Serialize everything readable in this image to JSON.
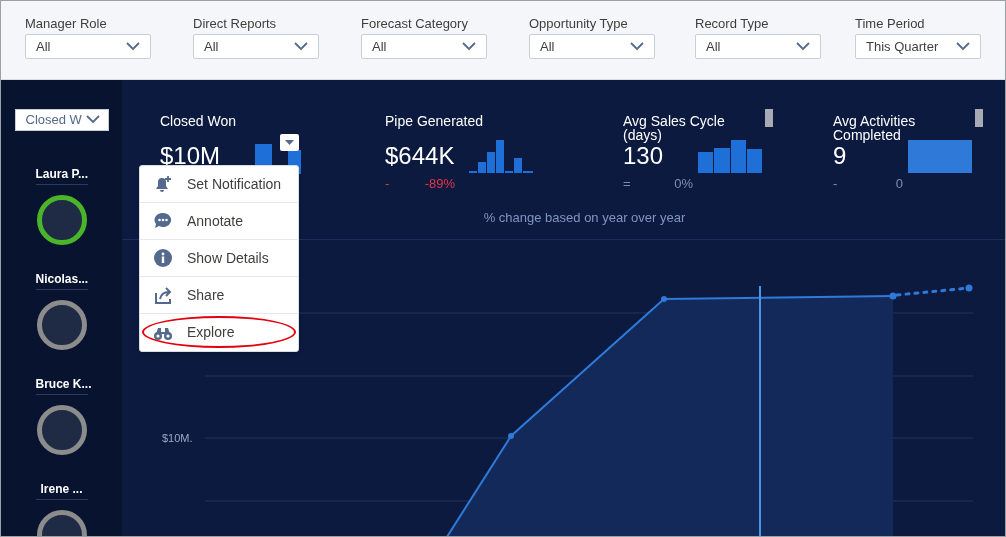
{
  "filters": [
    {
      "label": "Manager Role",
      "value": "All"
    },
    {
      "label": "Direct Reports",
      "value": "All"
    },
    {
      "label": "Forecast Category",
      "value": "All"
    },
    {
      "label": "Opportunity Type",
      "value": "All"
    },
    {
      "label": "Record Type",
      "value": "All"
    },
    {
      "label": "Time Period",
      "value": "This Quarter"
    }
  ],
  "sidebar": {
    "dropdown": "Closed W",
    "people": [
      {
        "name": "Laura P...",
        "color": "#4bb52a"
      },
      {
        "name": "Nicolas...",
        "color": "#8c8c8c"
      },
      {
        "name": "Bruce K...",
        "color": "#8c8c8c"
      },
      {
        "name": "Irene ...",
        "color": "#8c8c8c"
      }
    ]
  },
  "kpis": [
    {
      "title": "Closed Won",
      "value": "$10M"
    },
    {
      "title": "Pipe Generated",
      "value": "$644K",
      "indicator": "-",
      "change": "-89%",
      "negative": true
    },
    {
      "title": "Avg Sales Cycle (days)",
      "value": "130",
      "indicator": "=",
      "change": "0%",
      "negative": false
    },
    {
      "title": "Avg Activities Completed",
      "value": "9",
      "indicator": "-",
      "change": "0",
      "negative": false
    }
  ],
  "footnote": "% change based on year over year",
  "menu": {
    "items": [
      {
        "kind": "notify",
        "label": "Set Notification",
        "highlighted": false
      },
      {
        "kind": "annotate",
        "label": "Annotate",
        "highlighted": false
      },
      {
        "kind": "details",
        "label": "Show Details",
        "highlighted": false
      },
      {
        "kind": "share",
        "label": "Share",
        "highlighted": false
      },
      {
        "kind": "explore",
        "label": "Explore",
        "highlighted": true
      }
    ]
  },
  "chart": {
    "y_label": "$10M."
  }
}
